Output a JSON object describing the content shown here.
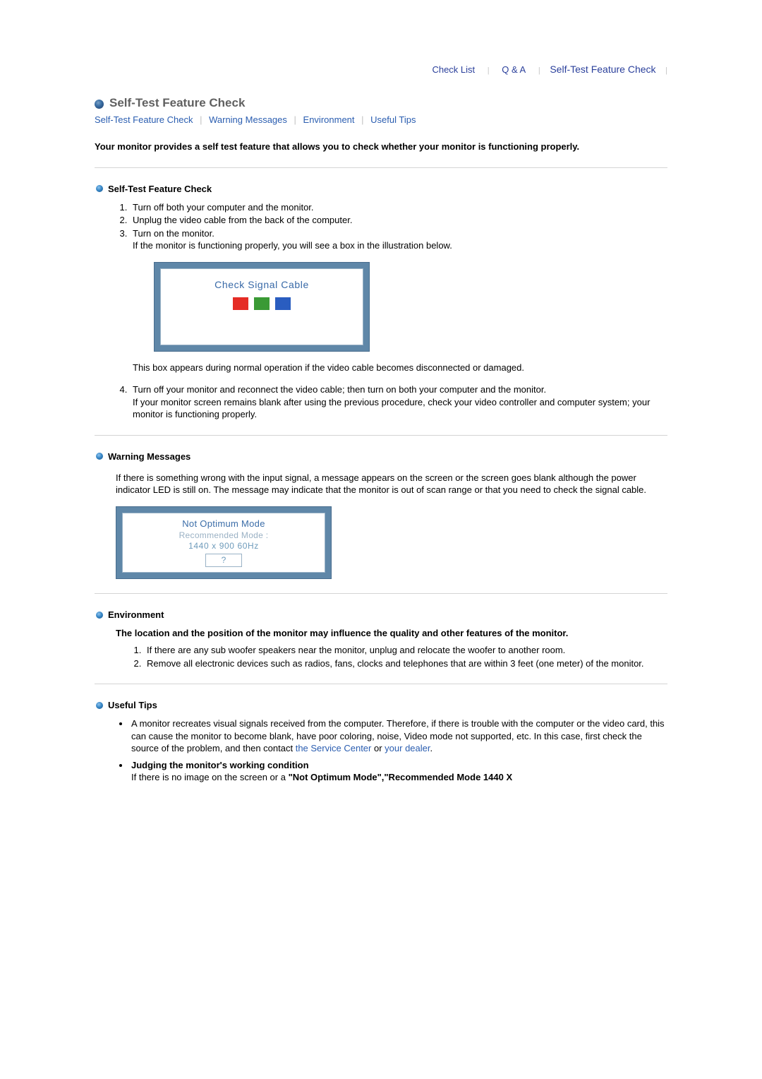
{
  "topnav": {
    "check_list": "Check List",
    "qa": "Q & A",
    "selftest": "Self-Test Feature Check"
  },
  "title": "Self-Test Feature Check",
  "anchors": {
    "selftest": "Self-Test Feature Check",
    "warning": "Warning Messages",
    "environment": "Environment",
    "tips": "Useful Tips"
  },
  "intro": "Your monitor provides a self test feature that allows you to check whether your monitor is functioning properly.",
  "section_selftest": {
    "heading": "Self-Test Feature Check",
    "steps": {
      "s1": "Turn off both your computer and the monitor.",
      "s2": "Unplug the video cable from the back of the computer.",
      "s3a": "Turn on the monitor.",
      "s3b": "If the monitor is functioning properly, you will see a box in the illustration below.",
      "illus_caption": "Check Signal Cable",
      "s3c": "This box appears during normal operation if the video cable becomes disconnected or damaged.",
      "s4a": "Turn off your monitor and reconnect the video cable; then turn on both your computer and the monitor.",
      "s4b": "If your monitor screen remains blank after using the previous procedure, check your video controller and computer system; your monitor is functioning properly."
    }
  },
  "section_warning": {
    "heading": "Warning Messages",
    "para": "If there is something wrong with the input signal, a message appears on the screen or the screen goes blank although the power indicator LED is still on. The message may indicate that the monitor is out of scan range or that you need to check the signal cable.",
    "illus": {
      "l1": "Not Optimum Mode",
      "l2": "Recommended Mode :",
      "l3": "1440 x 900 60Hz",
      "q": "?"
    }
  },
  "section_env": {
    "heading": "Environment",
    "intro": "The location and the position of the monitor may influence the quality and other features of the monitor.",
    "items": {
      "e1": "If there are any sub woofer speakers near the monitor, unplug and relocate the woofer to another room.",
      "e2": "Remove all electronic devices such as radios, fans, clocks and telephones that are within 3 feet (one meter) of the monitor."
    }
  },
  "section_tips": {
    "heading": "Useful Tips",
    "t1_a": "A monitor recreates visual signals received from the computer. Therefore, if there is trouble with the computer or the video card, this can cause the monitor to become blank, have poor coloring, noise, Video mode not supported, etc. In this case, first check the source of the problem, and then contact ",
    "t1_link1": "the Service Center",
    "t1_mid": " or ",
    "t1_link2": "your dealer",
    "t1_end": ".",
    "t2_head": "Judging the monitor's working condition",
    "t2_a": "If there is no image on the screen or a ",
    "t2_bold": "\"Not Optimum Mode\",\"Recommended Mode 1440 X"
  }
}
